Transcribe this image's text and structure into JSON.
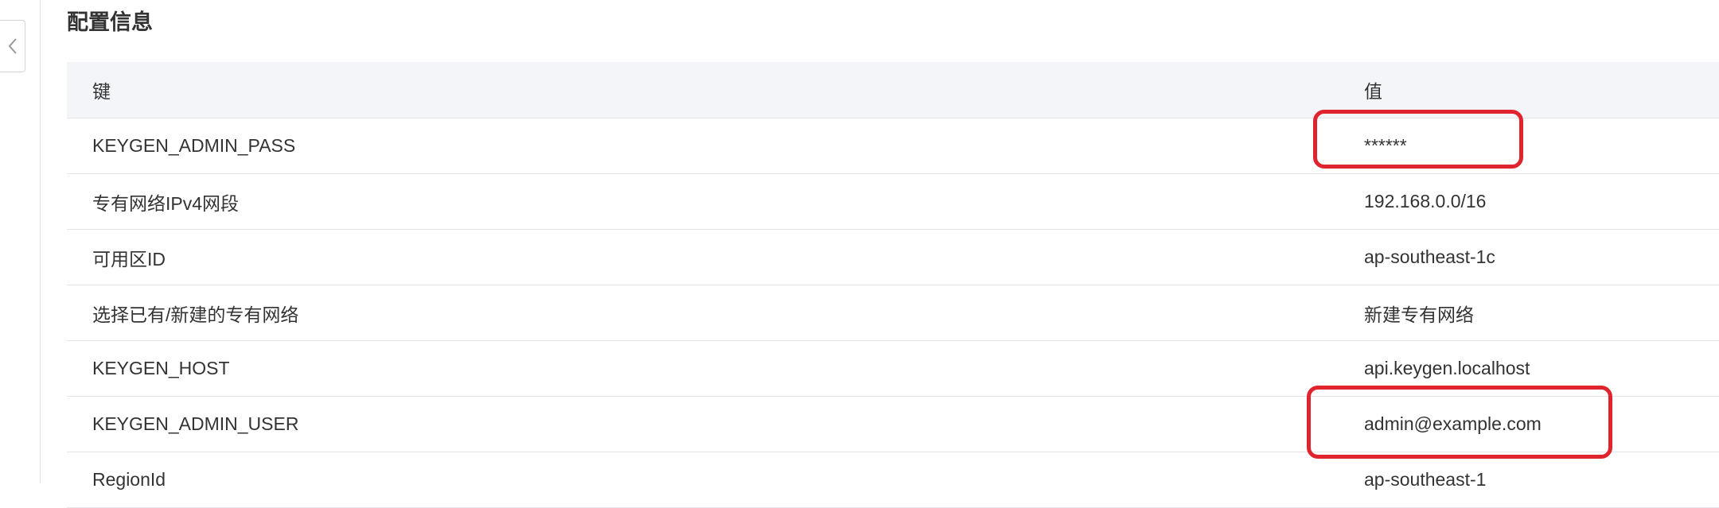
{
  "section": {
    "title": "配置信息"
  },
  "table": {
    "headers": {
      "key": "键",
      "value": "值"
    },
    "rows": [
      {
        "key": "KEYGEN_ADMIN_PASS",
        "value": "******"
      },
      {
        "key": "专有网络IPv4网段",
        "value": "192.168.0.0/16"
      },
      {
        "key": "可用区ID",
        "value": "ap-southeast-1c"
      },
      {
        "key": "选择已有/新建的专有网络",
        "value": "新建专有网络"
      },
      {
        "key": "KEYGEN_HOST",
        "value": "api.keygen.localhost"
      },
      {
        "key": "KEYGEN_ADMIN_USER",
        "value": "admin@example.com"
      },
      {
        "key": "RegionId",
        "value": "ap-southeast-1"
      }
    ]
  },
  "icons": {
    "collapse": "chevron-left-icon"
  },
  "colors": {
    "header_bg": "#f3f5f8",
    "highlight": "#e0242e",
    "text": "#333333"
  }
}
